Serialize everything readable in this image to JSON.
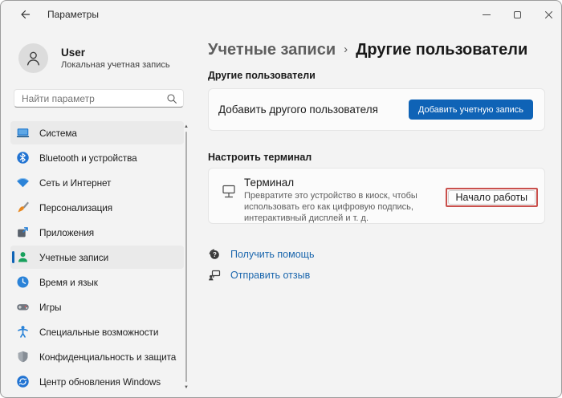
{
  "titlebar": {
    "title": "Параметры"
  },
  "user": {
    "name": "User",
    "account_type": "Локальная учетная запись"
  },
  "search": {
    "placeholder": "Найти параметр"
  },
  "sidebar": {
    "items": [
      {
        "label": "Система",
        "icon": "system-icon"
      },
      {
        "label": "Bluetooth и устройства",
        "icon": "bluetooth-icon"
      },
      {
        "label": "Сеть и Интернет",
        "icon": "network-icon"
      },
      {
        "label": "Персонализация",
        "icon": "personalization-icon"
      },
      {
        "label": "Приложения",
        "icon": "apps-icon"
      },
      {
        "label": "Учетные записи",
        "icon": "accounts-icon",
        "selected": true
      },
      {
        "label": "Время и язык",
        "icon": "time-language-icon"
      },
      {
        "label": "Игры",
        "icon": "gaming-icon"
      },
      {
        "label": "Специальные возможности",
        "icon": "accessibility-icon"
      },
      {
        "label": "Конфиденциальность и защита",
        "icon": "privacy-icon"
      },
      {
        "label": "Центр обновления Windows",
        "icon": "windows-update-icon"
      }
    ]
  },
  "content": {
    "breadcrumb": {
      "parent": "Учетные записи",
      "separator": "›",
      "current": "Другие пользователи"
    },
    "other_users_section": {
      "header": "Другие пользователи",
      "add_user_label": "Добавить другого пользователя",
      "add_account_button": "Добавить учетную запись"
    },
    "kiosk_section": {
      "header": "Настроить терминал",
      "title": "Терминал",
      "description": "Превратите это устройство в киоск, чтобы использовать его как цифровую подпись, интерактивный дисплей и т. д.",
      "get_started_button": "Начало работы"
    },
    "footer_links": [
      {
        "label": "Получить помощь"
      },
      {
        "label": "Отправить отзыв"
      }
    ]
  },
  "colors": {
    "accent": "#0f63b6",
    "link": "#1a66ad",
    "annotation_red": "#c9504c"
  }
}
